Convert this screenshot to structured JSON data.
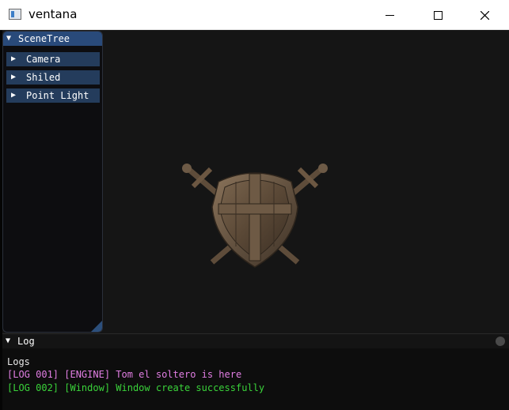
{
  "window": {
    "title": "ventana"
  },
  "scenetree": {
    "title": "SceneTree",
    "items": [
      {
        "label": "Camera"
      },
      {
        "label": "Shiled"
      },
      {
        "label": "Point Light"
      }
    ]
  },
  "log": {
    "title": "Log",
    "section": "Logs",
    "entries": [
      {
        "text": "[LOG 001] [ENGINE] Tom el soltero is here",
        "color": "#e17ee3"
      },
      {
        "text": "[LOG 002] [Window] Window create successfully",
        "color": "#3ad33a"
      }
    ]
  },
  "icons": {
    "app": "window-app-icon",
    "minimize": "minimize-icon",
    "maximize": "maximize-icon",
    "close": "close-icon",
    "expand": "triangle-down-icon",
    "collapsed": "triangle-right-icon"
  },
  "colors": {
    "viewport_bg": "#151515",
    "panel_header": "#294a7a",
    "tree_item": "#243c5c"
  }
}
